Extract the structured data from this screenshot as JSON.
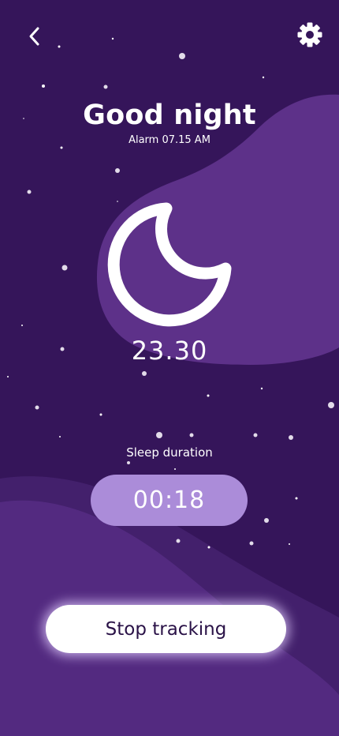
{
  "header": {
    "back_icon": "chevron-left-icon",
    "settings_icon": "gear-icon"
  },
  "greeting": {
    "title": "Good night",
    "alarm_text": "Alarm 07.15 AM"
  },
  "moon_icon": "moon-icon",
  "bedtime": "23.30",
  "sleep": {
    "label": "Sleep duration",
    "timer": "00:18"
  },
  "actions": {
    "stop_label": "Stop tracking"
  },
  "colors": {
    "background": "#35155a",
    "blob": "#5d3189",
    "timer_pill": "#ab8cd9",
    "button_text": "#2a1247"
  }
}
